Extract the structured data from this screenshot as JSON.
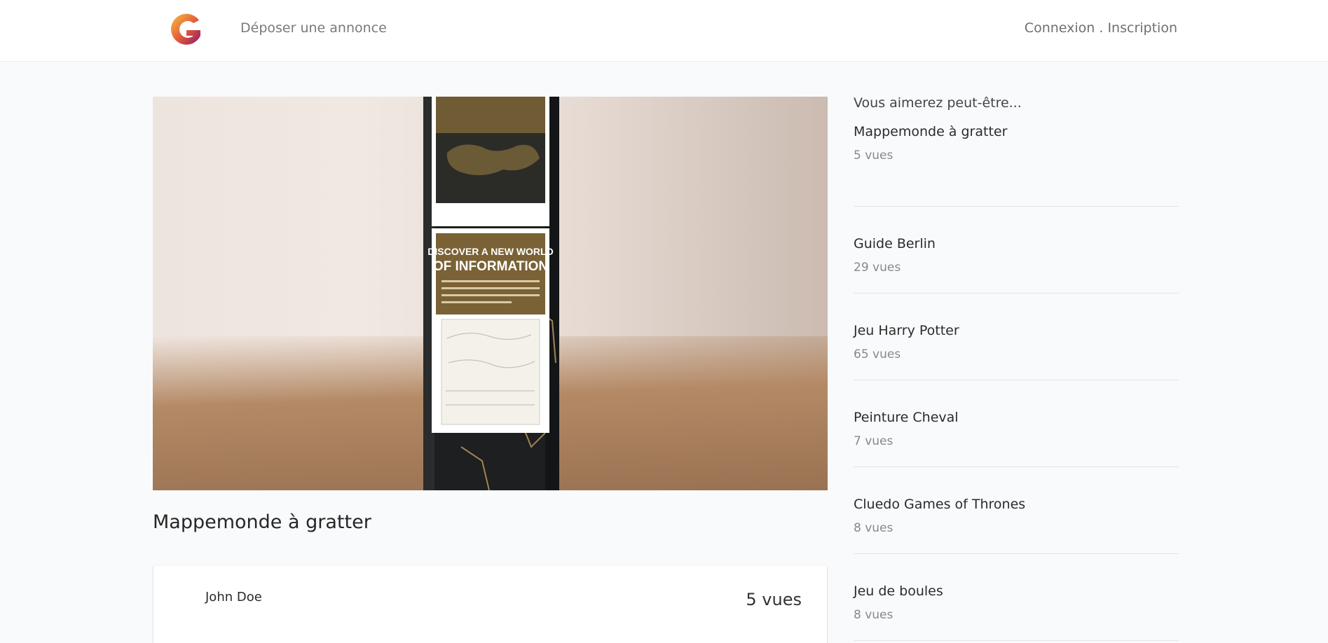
{
  "navbar": {
    "logo_icon": "g-logo-icon",
    "post_ad_label": "Déposer une annonce",
    "login_label": "Connexion",
    "separator": " . ",
    "signup_label": "Inscription"
  },
  "listing": {
    "title": "Mappemonde à gratter",
    "photo_lines": {
      "headline_1": "DISCOVER A NEW WORLD",
      "headline_2": "OF INFORMATION"
    },
    "seller": {
      "name": "John Doe",
      "views": "5 vues"
    }
  },
  "sidebar": {
    "heading": "Vous aimerez peut-être...",
    "items": [
      {
        "name": "Mappemonde à gratter",
        "views": "5 vues"
      },
      {
        "name": "Guide Berlin",
        "views": "29 vues"
      },
      {
        "name": "Jeu Harry Potter",
        "views": "65 vues"
      },
      {
        "name": "Peinture Cheval",
        "views": "7 vues"
      },
      {
        "name": "Cluedo Games of Thrones",
        "views": "8 vues"
      },
      {
        "name": "Jeu de boules",
        "views": "8 vues"
      }
    ]
  },
  "colors": {
    "logo_gradient_start": "#f6c244",
    "logo_gradient_end": "#8c1a6a",
    "background": "#f9fafc"
  }
}
